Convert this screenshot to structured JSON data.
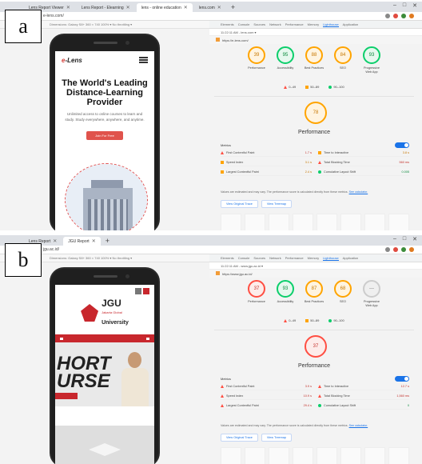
{
  "panels": {
    "a": {
      "label": "a",
      "tabs": [
        "Lens Report Viewer",
        "Lens Report - Elearning",
        "lens - online education",
        "lens.com"
      ],
      "address": "e-lens.com/",
      "device_bar": "Dimensions: Galaxy S8+  360  ×  740  100% ▾  No throttling ▾",
      "devtools_tabs": [
        "Elements",
        "Console",
        "Sources",
        "Network",
        "Performance",
        "Memory",
        "Lighthouse",
        "Application"
      ],
      "devtools_url": "11:22:11 AM - lens.com ▾",
      "report_url": "https://e-lens.com/",
      "site": {
        "logo_accent": "e",
        "logo_rest": "-Lens",
        "hero_title": "The World's Leading Distance-Learning Provider",
        "hero_sub": "Unlimited access to online courses to learn and study. Study everywhere, anywhere, and anytime.",
        "hero_button": "Join For Free"
      },
      "scores": [
        {
          "value": "39",
          "label": "Performance",
          "status": "avg"
        },
        {
          "value": "95",
          "label": "Accessibility",
          "status": "pass"
        },
        {
          "value": "88",
          "label": "Best Practices",
          "status": "avg"
        },
        {
          "value": "84",
          "label": "SEO",
          "status": "avg"
        },
        {
          "value": "93",
          "label": "Progressive Web App",
          "status": "pass"
        }
      ],
      "legend": [
        "0–49",
        "50–89",
        "90–100"
      ],
      "perf_score": "78",
      "perf_status": "avg",
      "perf_title": "Performance",
      "metrics_title": "Metrics",
      "metrics": [
        {
          "label": "First Contentful Paint",
          "value": "1.7 s",
          "status": "red"
        },
        {
          "label": "Time to Interactive",
          "value": "3.8 s",
          "status": "orange"
        },
        {
          "label": "Speed Index",
          "value": "3.1 s",
          "status": "orange"
        },
        {
          "label": "Total Blocking Time",
          "value": "560 ms",
          "status": "red"
        },
        {
          "label": "Largest Contentful Paint",
          "value": "2.4 s",
          "status": "orange"
        },
        {
          "label": "Cumulative Layout Shift",
          "value": "0.005",
          "status": "green"
        }
      ],
      "note_text": "Values are estimated and may vary. The performance score is calculated directly from these metrics.",
      "note_link": "See calculator.",
      "btn_treemap": "View Original Trace",
      "btn_trace": "View Treemap"
    },
    "b": {
      "label": "b",
      "tabs": [
        "Lens Report",
        "JGU Report"
      ],
      "address": "jgu.ac.id/",
      "device_bar": "Dimensions: Galaxy S8+  360  ×  740  100% ▾  No throttling ▾",
      "devtools_tabs": [
        "Elements",
        "Console",
        "Sources",
        "Network",
        "Performance",
        "Memory",
        "Lighthouse",
        "Application"
      ],
      "devtools_url": "11:22:11 AM - www.jgu.ac.id ▾",
      "report_url": "https://www.jgu.ac.id/",
      "site": {
        "logo": "JGU",
        "logo_small": "Jakarta Global",
        "logo_uni": "University",
        "banner_line1": "HORT",
        "banner_line2": "URSE"
      },
      "scores": [
        {
          "value": "37",
          "label": "Performance",
          "status": "fail"
        },
        {
          "value": "93",
          "label": "Accessibility",
          "status": "pass"
        },
        {
          "value": "87",
          "label": "Best Practices",
          "status": "avg"
        },
        {
          "value": "68",
          "label": "SEO",
          "status": "avg"
        },
        {
          "value": "—",
          "label": "Progressive Web App",
          "status": "na"
        }
      ],
      "legend": [
        "0–49",
        "50–89",
        "90–100"
      ],
      "perf_score": "37",
      "perf_status": "fail",
      "perf_title": "Performance",
      "metrics_title": "Metrics",
      "metrics": [
        {
          "label": "First Contentful Paint",
          "value": "3.9 s",
          "status": "red"
        },
        {
          "label": "Time to Interactive",
          "value": "12.7 s",
          "status": "red"
        },
        {
          "label": "Speed Index",
          "value": "10.9 s",
          "status": "red"
        },
        {
          "label": "Total Blocking Time",
          "value": "1,560 ms",
          "status": "red"
        },
        {
          "label": "Largest Contentful Paint",
          "value": "29.4 s",
          "status": "red"
        },
        {
          "label": "Cumulative Layout Shift",
          "value": "0",
          "status": "green"
        }
      ],
      "note_text": "Values are estimated and may vary. The performance score is calculated directly from these metrics.",
      "note_link": "See calculator.",
      "btn_treemap": "View Original Trace",
      "btn_trace": "View Treemap"
    }
  }
}
